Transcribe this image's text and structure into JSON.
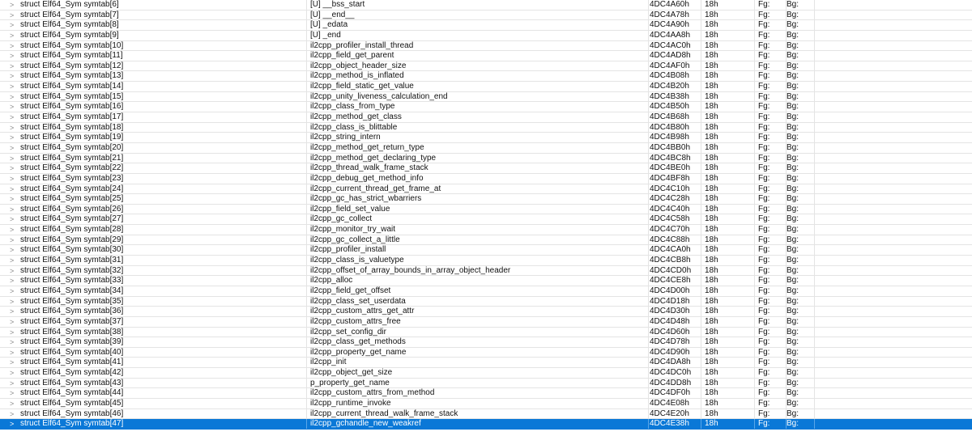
{
  "expand_glyph": ">",
  "selected_row_index": 41,
  "colors": {
    "selection": "#0a78d7",
    "grid": "#e4e4e4",
    "text": "#111111"
  },
  "rows": [
    {
      "name": "struct Elf64_Sym symtab[6]",
      "value": "[U] __bss_start",
      "start": "4DC4A60h",
      "size": "18h",
      "fg": "Fg:",
      "bg": "Bg:"
    },
    {
      "name": "struct Elf64_Sym symtab[7]",
      "value": "[U] __end__",
      "start": "4DC4A78h",
      "size": "18h",
      "fg": "Fg:",
      "bg": "Bg:"
    },
    {
      "name": "struct Elf64_Sym symtab[8]",
      "value": "[U] _edata",
      "start": "4DC4A90h",
      "size": "18h",
      "fg": "Fg:",
      "bg": "Bg:"
    },
    {
      "name": "struct Elf64_Sym symtab[9]",
      "value": "[U] _end",
      "start": "4DC4AA8h",
      "size": "18h",
      "fg": "Fg:",
      "bg": "Bg:"
    },
    {
      "name": "struct Elf64_Sym symtab[10]",
      "value": "il2cpp_profiler_install_thread",
      "start": "4DC4AC0h",
      "size": "18h",
      "fg": "Fg:",
      "bg": "Bg:"
    },
    {
      "name": "struct Elf64_Sym symtab[11]",
      "value": "il2cpp_field_get_parent",
      "start": "4DC4AD8h",
      "size": "18h",
      "fg": "Fg:",
      "bg": "Bg:"
    },
    {
      "name": "struct Elf64_Sym symtab[12]",
      "value": "il2cpp_object_header_size",
      "start": "4DC4AF0h",
      "size": "18h",
      "fg": "Fg:",
      "bg": "Bg:"
    },
    {
      "name": "struct Elf64_Sym symtab[13]",
      "value": "il2cpp_method_is_inflated",
      "start": "4DC4B08h",
      "size": "18h",
      "fg": "Fg:",
      "bg": "Bg:"
    },
    {
      "name": "struct Elf64_Sym symtab[14]",
      "value": "il2cpp_field_static_get_value",
      "start": "4DC4B20h",
      "size": "18h",
      "fg": "Fg:",
      "bg": "Bg:"
    },
    {
      "name": "struct Elf64_Sym symtab[15]",
      "value": "il2cpp_unity_liveness_calculation_end",
      "start": "4DC4B38h",
      "size": "18h",
      "fg": "Fg:",
      "bg": "Bg:"
    },
    {
      "name": "struct Elf64_Sym symtab[16]",
      "value": "il2cpp_class_from_type",
      "start": "4DC4B50h",
      "size": "18h",
      "fg": "Fg:",
      "bg": "Bg:"
    },
    {
      "name": "struct Elf64_Sym symtab[17]",
      "value": "il2cpp_method_get_class",
      "start": "4DC4B68h",
      "size": "18h",
      "fg": "Fg:",
      "bg": "Bg:"
    },
    {
      "name": "struct Elf64_Sym symtab[18]",
      "value": "il2cpp_class_is_blittable",
      "start": "4DC4B80h",
      "size": "18h",
      "fg": "Fg:",
      "bg": "Bg:"
    },
    {
      "name": "struct Elf64_Sym symtab[19]",
      "value": "il2cpp_string_intern",
      "start": "4DC4B98h",
      "size": "18h",
      "fg": "Fg:",
      "bg": "Bg:"
    },
    {
      "name": "struct Elf64_Sym symtab[20]",
      "value": "il2cpp_method_get_return_type",
      "start": "4DC4BB0h",
      "size": "18h",
      "fg": "Fg:",
      "bg": "Bg:"
    },
    {
      "name": "struct Elf64_Sym symtab[21]",
      "value": "il2cpp_method_get_declaring_type",
      "start": "4DC4BC8h",
      "size": "18h",
      "fg": "Fg:",
      "bg": "Bg:"
    },
    {
      "name": "struct Elf64_Sym symtab[22]",
      "value": "il2cpp_thread_walk_frame_stack",
      "start": "4DC4BE0h",
      "size": "18h",
      "fg": "Fg:",
      "bg": "Bg:"
    },
    {
      "name": "struct Elf64_Sym symtab[23]",
      "value": "il2cpp_debug_get_method_info",
      "start": "4DC4BF8h",
      "size": "18h",
      "fg": "Fg:",
      "bg": "Bg:"
    },
    {
      "name": "struct Elf64_Sym symtab[24]",
      "value": "il2cpp_current_thread_get_frame_at",
      "start": "4DC4C10h",
      "size": "18h",
      "fg": "Fg:",
      "bg": "Bg:"
    },
    {
      "name": "struct Elf64_Sym symtab[25]",
      "value": "il2cpp_gc_has_strict_wbarriers",
      "start": "4DC4C28h",
      "size": "18h",
      "fg": "Fg:",
      "bg": "Bg:"
    },
    {
      "name": "struct Elf64_Sym symtab[26]",
      "value": "il2cpp_field_set_value",
      "start": "4DC4C40h",
      "size": "18h",
      "fg": "Fg:",
      "bg": "Bg:"
    },
    {
      "name": "struct Elf64_Sym symtab[27]",
      "value": "il2cpp_gc_collect",
      "start": "4DC4C58h",
      "size": "18h",
      "fg": "Fg:",
      "bg": "Bg:"
    },
    {
      "name": "struct Elf64_Sym symtab[28]",
      "value": "il2cpp_monitor_try_wait",
      "start": "4DC4C70h",
      "size": "18h",
      "fg": "Fg:",
      "bg": "Bg:"
    },
    {
      "name": "struct Elf64_Sym symtab[29]",
      "value": "il2cpp_gc_collect_a_little",
      "start": "4DC4C88h",
      "size": "18h",
      "fg": "Fg:",
      "bg": "Bg:"
    },
    {
      "name": "struct Elf64_Sym symtab[30]",
      "value": "il2cpp_profiler_install",
      "start": "4DC4CA0h",
      "size": "18h",
      "fg": "Fg:",
      "bg": "Bg:"
    },
    {
      "name": "struct Elf64_Sym symtab[31]",
      "value": "il2cpp_class_is_valuetype",
      "start": "4DC4CB8h",
      "size": "18h",
      "fg": "Fg:",
      "bg": "Bg:"
    },
    {
      "name": "struct Elf64_Sym symtab[32]",
      "value": "il2cpp_offset_of_array_bounds_in_array_object_header",
      "start": "4DC4CD0h",
      "size": "18h",
      "fg": "Fg:",
      "bg": "Bg:"
    },
    {
      "name": "struct Elf64_Sym symtab[33]",
      "value": "il2cpp_alloc",
      "start": "4DC4CE8h",
      "size": "18h",
      "fg": "Fg:",
      "bg": "Bg:"
    },
    {
      "name": "struct Elf64_Sym symtab[34]",
      "value": "il2cpp_field_get_offset",
      "start": "4DC4D00h",
      "size": "18h",
      "fg": "Fg:",
      "bg": "Bg:"
    },
    {
      "name": "struct Elf64_Sym symtab[35]",
      "value": "il2cpp_class_set_userdata",
      "start": "4DC4D18h",
      "size": "18h",
      "fg": "Fg:",
      "bg": "Bg:"
    },
    {
      "name": "struct Elf64_Sym symtab[36]",
      "value": "il2cpp_custom_attrs_get_attr",
      "start": "4DC4D30h",
      "size": "18h",
      "fg": "Fg:",
      "bg": "Bg:"
    },
    {
      "name": "struct Elf64_Sym symtab[37]",
      "value": "il2cpp_custom_attrs_free",
      "start": "4DC4D48h",
      "size": "18h",
      "fg": "Fg:",
      "bg": "Bg:"
    },
    {
      "name": "struct Elf64_Sym symtab[38]",
      "value": "il2cpp_set_config_dir",
      "start": "4DC4D60h",
      "size": "18h",
      "fg": "Fg:",
      "bg": "Bg:"
    },
    {
      "name": "struct Elf64_Sym symtab[39]",
      "value": "il2cpp_class_get_methods",
      "start": "4DC4D78h",
      "size": "18h",
      "fg": "Fg:",
      "bg": "Bg:"
    },
    {
      "name": "struct Elf64_Sym symtab[40]",
      "value": "il2cpp_property_get_name",
      "start": "4DC4D90h",
      "size": "18h",
      "fg": "Fg:",
      "bg": "Bg:"
    },
    {
      "name": "struct Elf64_Sym symtab[41]",
      "value": "il2cpp_init",
      "start": "4DC4DA8h",
      "size": "18h",
      "fg": "Fg:",
      "bg": "Bg:"
    },
    {
      "name": "struct Elf64_Sym symtab[42]",
      "value": "il2cpp_object_get_size",
      "start": "4DC4DC0h",
      "size": "18h",
      "fg": "Fg:",
      "bg": "Bg:"
    },
    {
      "name": "struct Elf64_Sym symtab[43]",
      "value": "p_property_get_name",
      "start": "4DC4DD8h",
      "size": "18h",
      "fg": "Fg:",
      "bg": "Bg:"
    },
    {
      "name": "struct Elf64_Sym symtab[44]",
      "value": "il2cpp_custom_attrs_from_method",
      "start": "4DC4DF0h",
      "size": "18h",
      "fg": "Fg:",
      "bg": "Bg:"
    },
    {
      "name": "struct Elf64_Sym symtab[45]",
      "value": "il2cpp_runtime_invoke",
      "start": "4DC4E08h",
      "size": "18h",
      "fg": "Fg:",
      "bg": "Bg:"
    },
    {
      "name": "struct Elf64_Sym symtab[46]",
      "value": "il2cpp_current_thread_walk_frame_stack",
      "start": "4DC4E20h",
      "size": "18h",
      "fg": "Fg:",
      "bg": "Bg:"
    },
    {
      "name": "struct Elf64_Sym symtab[47]",
      "value": "il2cpp_gchandle_new_weakref",
      "start": "4DC4E38h",
      "size": "18h",
      "fg": "Fg:",
      "bg": "Bg:"
    }
  ]
}
